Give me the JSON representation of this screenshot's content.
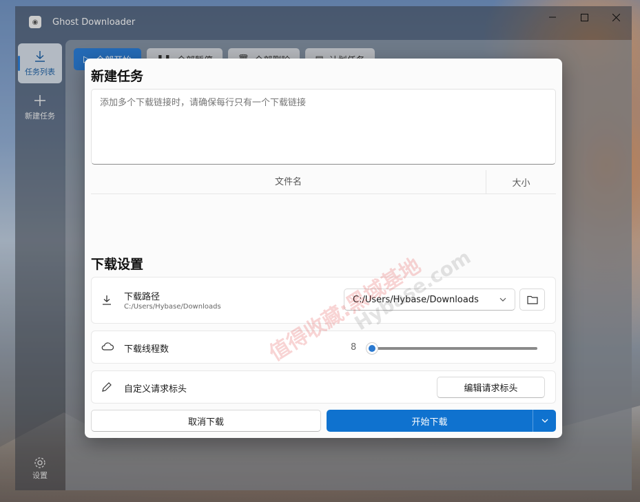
{
  "window": {
    "title": "Ghost Downloader",
    "controls": [
      "minimize",
      "maximize",
      "close"
    ]
  },
  "sidebar": {
    "items": [
      {
        "label": "任务列表",
        "icon": "download-icon",
        "active": true
      },
      {
        "label": "新建任务",
        "icon": "plus-icon",
        "active": false
      }
    ],
    "settings_label": "设置"
  },
  "toolbar": {
    "buttons": [
      {
        "label": "全部开始",
        "icon": "play-icon"
      },
      {
        "label": "全部暂停",
        "icon": "pause-icon"
      },
      {
        "label": "全部删除",
        "icon": "trash-icon"
      },
      {
        "label": "计划任务",
        "icon": "schedule-icon"
      }
    ]
  },
  "dialog": {
    "title": "新建任务",
    "url_placeholder": "添加多个下载链接时，请确保每行只有一个下载链接",
    "table_headers": {
      "name": "文件名",
      "size": "大小"
    },
    "settings_title": "下载设置",
    "path": {
      "label": "下载路径",
      "sub": "C:/Users/Hybase/Downloads",
      "selected": "C:/Users/Hybase/Downloads"
    },
    "threads": {
      "label": "下载线程数",
      "value": "8"
    },
    "headers": {
      "label": "自定义请求标头",
      "button": "编辑请求标头"
    },
    "cancel_label": "取消下载",
    "start_label": "开始下载",
    "accent": "#0f72cf"
  },
  "watermark": {
    "cn": "值得收藏:黑域基地",
    "en": "Hybase.com"
  }
}
